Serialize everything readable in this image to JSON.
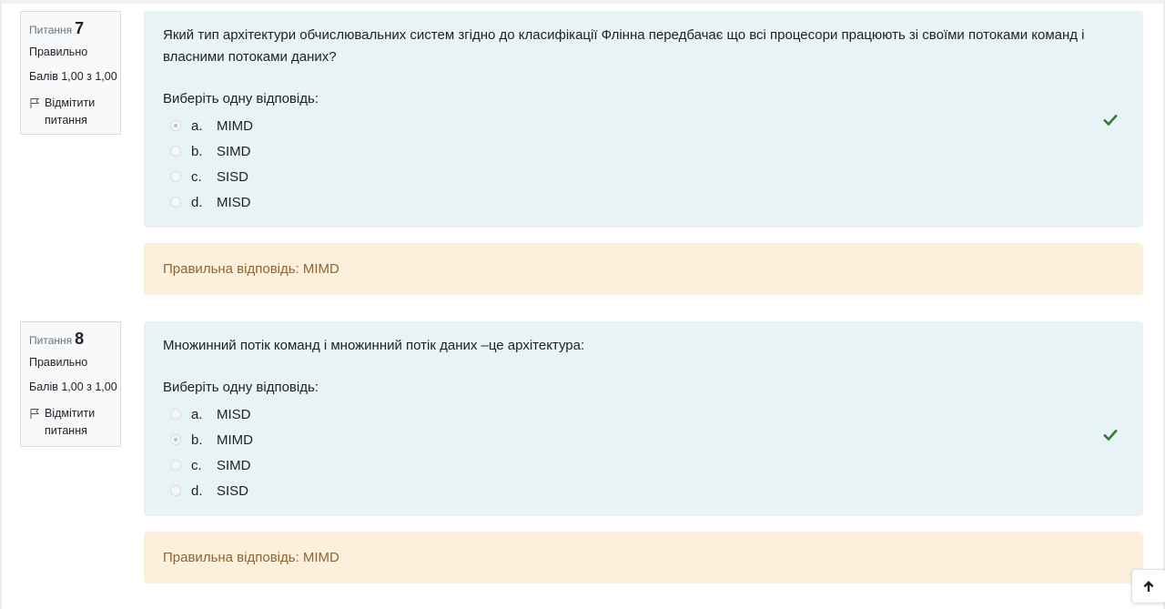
{
  "questions": [
    {
      "number_label": "Питання",
      "number": "7",
      "state": "Правильно",
      "grade": "Балів 1,00 з 1,00",
      "flag_label": "Відмітити питання",
      "text": "Який тип архітектури обчислювальних систем згідно до класифікації Флінна передбачає що всі процесори працюють зі своїми потоками команд і власними потоками даних?",
      "prompt": "Виберіть одну відповідь:",
      "options": [
        {
          "letter": "a.",
          "text": "MIMD",
          "selected": true
        },
        {
          "letter": "b.",
          "text": "SIMD",
          "selected": false
        },
        {
          "letter": "c.",
          "text": "SISD",
          "selected": false
        },
        {
          "letter": "d.",
          "text": "MISD",
          "selected": false
        }
      ],
      "correct_icon": "check-icon",
      "feedback": "Правильна відповідь: MIMD"
    },
    {
      "number_label": "Питання",
      "number": "8",
      "state": "Правильно",
      "grade": "Балів 1,00 з 1,00",
      "flag_label": "Відмітити питання",
      "text": "Множинний потік команд і множинний потік даних –це архітектура:",
      "prompt": "Виберіть одну відповідь:",
      "options": [
        {
          "letter": "a.",
          "text": "MISD",
          "selected": false
        },
        {
          "letter": "b.",
          "text": "MIMD",
          "selected": true
        },
        {
          "letter": "c.",
          "text": "SIMD",
          "selected": false
        },
        {
          "letter": "d.",
          "text": "SISD",
          "selected": false
        }
      ],
      "correct_icon": "check-icon",
      "feedback": "Правильна відповідь: MIMD"
    }
  ],
  "colors": {
    "formulation_bg": "#e7f3f5",
    "feedback_bg": "#fcefdc",
    "feedback_text": "#8e662e",
    "check": "#357a32"
  },
  "scroll_top_icon": "arrow-up-icon"
}
